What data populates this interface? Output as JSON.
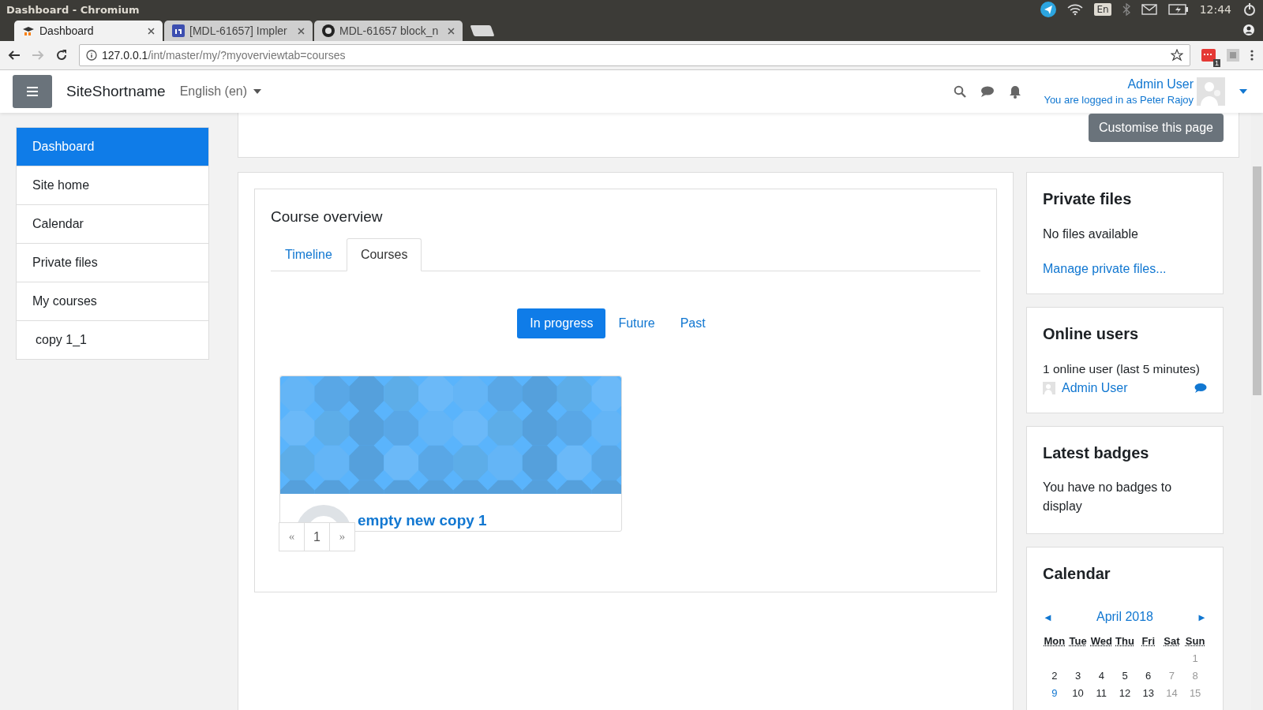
{
  "os_bar": {
    "title": "Dashboard - Chromium",
    "keyboard": "En",
    "time": "12:44"
  },
  "browser": {
    "tabs": [
      {
        "title": "Dashboard",
        "selected": true
      },
      {
        "title": "[MDL-61657] Impler",
        "selected": false
      },
      {
        "title": "MDL-61657 block_n",
        "selected": false
      }
    ],
    "url_host": "127.0.0.1",
    "url_path": "/int/master/my/?myoverviewtab=courses",
    "extension_badge": "1"
  },
  "navbar": {
    "site_name": "SiteShortname",
    "language": "English (en)",
    "user_name": "Admin User",
    "logged_in_as": "You are logged in as Peter Rajoy"
  },
  "customise_button": "Customise this page",
  "sidebar": {
    "items": [
      {
        "label": "Dashboard",
        "selected": true
      },
      {
        "label": "Site home",
        "selected": false
      },
      {
        "label": "Calendar",
        "selected": false
      },
      {
        "label": "Private files",
        "selected": false
      },
      {
        "label": "My courses",
        "selected": false
      },
      {
        "label": "copy 1_1",
        "selected": false
      }
    ]
  },
  "course_overview": {
    "title": "Course overview",
    "tabs": [
      {
        "label": "Timeline",
        "selected": false
      },
      {
        "label": "Courses",
        "selected": true
      }
    ],
    "filters": [
      {
        "label": "In progress",
        "selected": true
      },
      {
        "label": "Future",
        "selected": false
      },
      {
        "label": "Past",
        "selected": false
      }
    ],
    "courses": [
      {
        "name": "empty new copy 1"
      }
    ],
    "pagination": {
      "prev": "«",
      "page": "1",
      "next": "»"
    }
  },
  "private_files": {
    "title": "Private files",
    "text": "No files available",
    "link": "Manage private files..."
  },
  "online_users": {
    "title": "Online users",
    "summary": "1 online user (last 5 minutes)",
    "users": [
      {
        "name": "Admin User"
      }
    ]
  },
  "latest_badges": {
    "title": "Latest badges",
    "text": "You have no badges to display"
  },
  "calendar": {
    "title": "Calendar",
    "prev": "◄",
    "month": "April 2018",
    "next": "►",
    "weekdays": [
      "Mon",
      "Tue",
      "Wed",
      "Thu",
      "Fri",
      "Sat",
      "Sun"
    ],
    "weeks": [
      [
        {
          "day": "1",
          "kind": "weekend"
        }
      ],
      [
        {
          "day": "2",
          "kind": "weekday"
        },
        {
          "day": "3",
          "kind": "weekday"
        },
        {
          "day": "4",
          "kind": "weekday"
        },
        {
          "day": "5",
          "kind": "weekday"
        },
        {
          "day": "6",
          "kind": "weekday"
        },
        {
          "day": "7",
          "kind": "weekend"
        },
        {
          "day": "8",
          "kind": "weekend"
        }
      ],
      [
        {
          "day": "9",
          "kind": "today"
        },
        {
          "day": "10",
          "kind": "weekday"
        },
        {
          "day": "11",
          "kind": "weekday"
        },
        {
          "day": "12",
          "kind": "weekday"
        },
        {
          "day": "13",
          "kind": "weekday"
        },
        {
          "day": "14",
          "kind": "weekend"
        },
        {
          "day": "15",
          "kind": "weekend"
        }
      ]
    ]
  }
}
